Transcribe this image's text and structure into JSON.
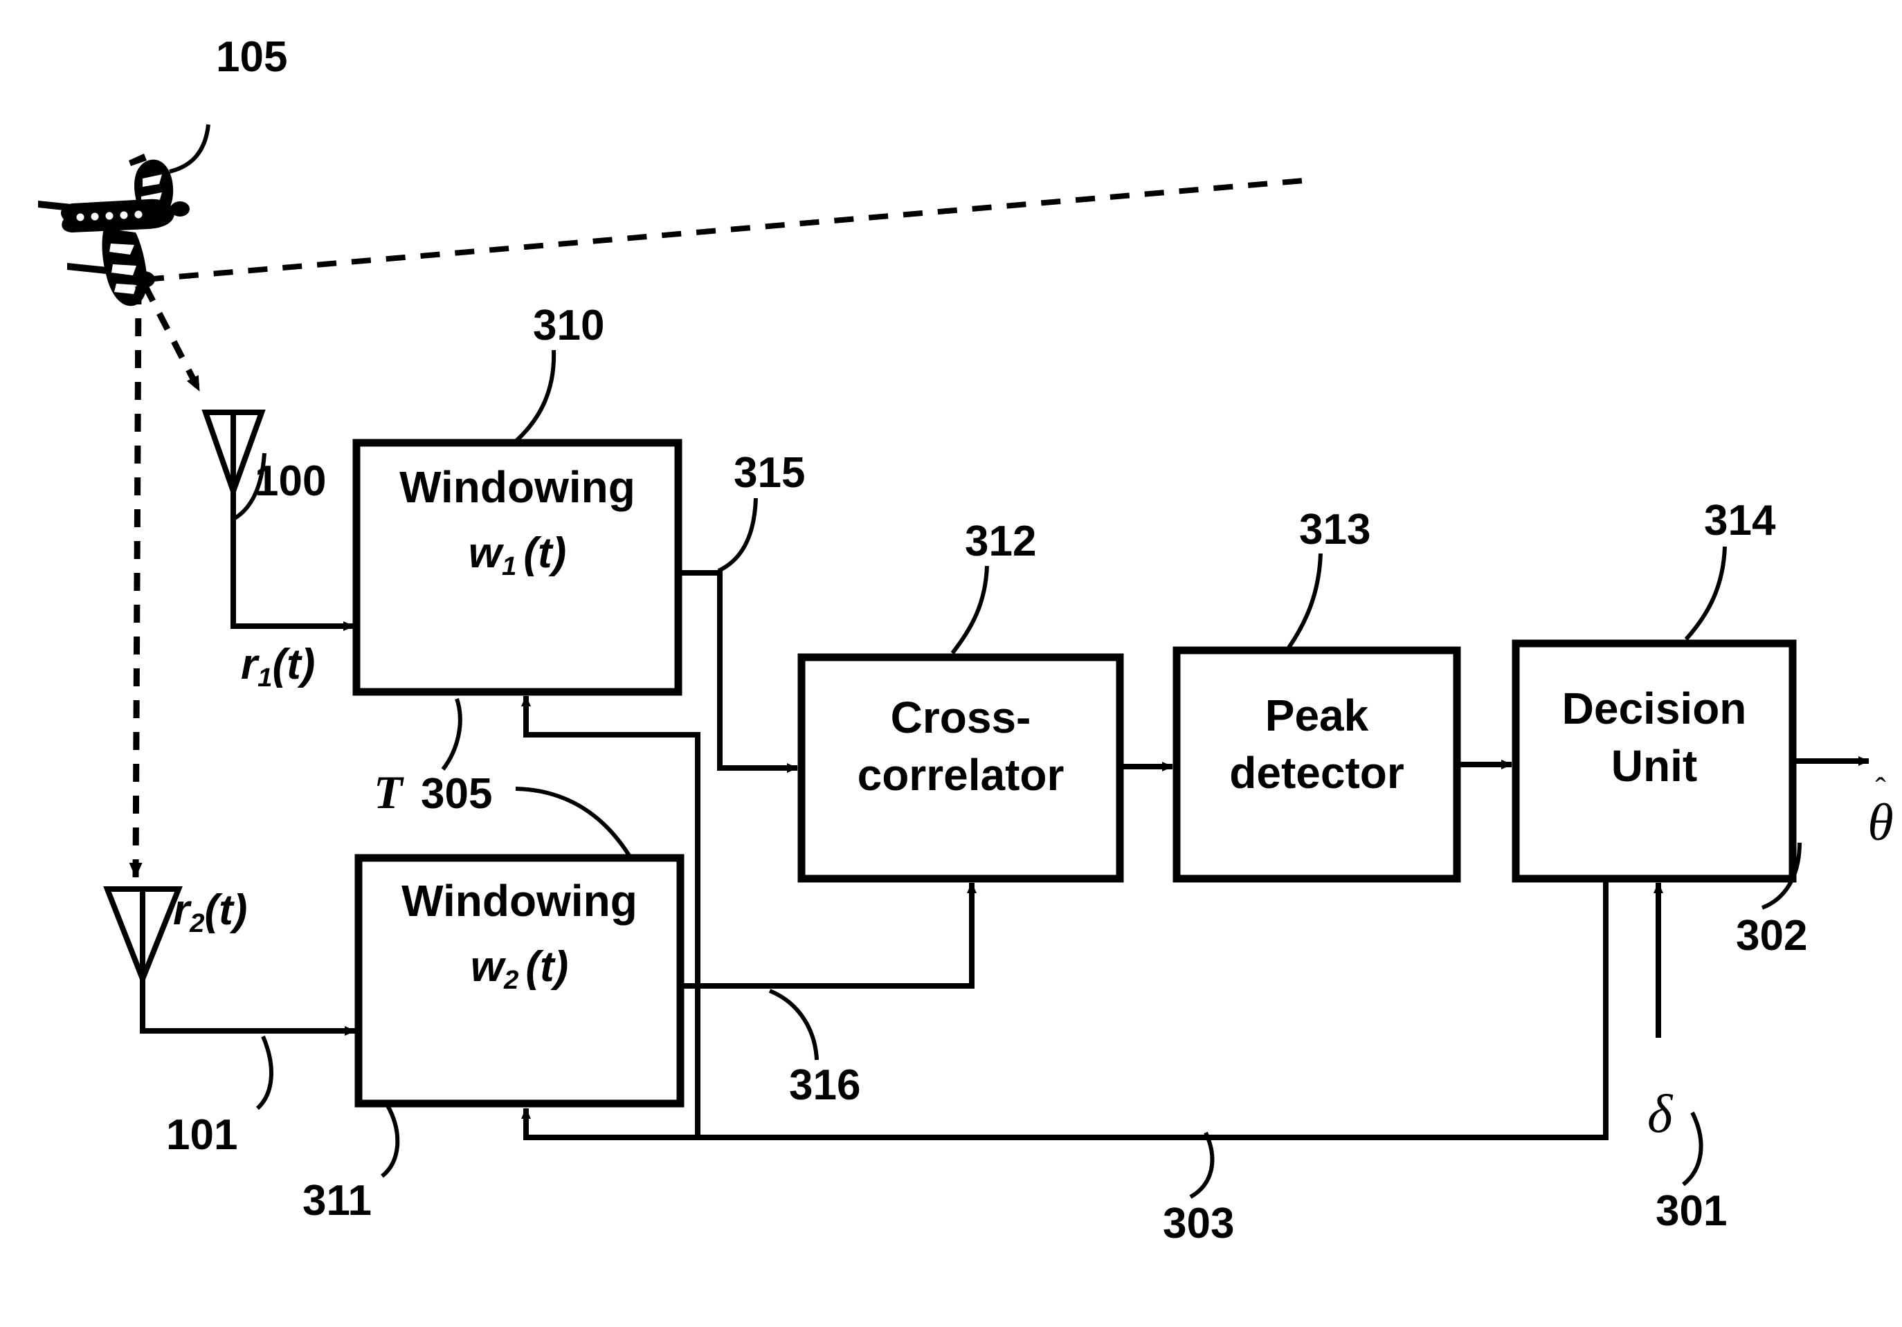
{
  "figure": {
    "type": "patent-block-diagram",
    "background": "#ffffff",
    "stroke": "#000000"
  },
  "scene": {
    "aircraft_ref": "105",
    "antenna1_ref": "100",
    "antenna2_ref": "101",
    "signal1": "r",
    "signal1_sub": "1",
    "signal1_arg": "(t)",
    "signal2": "r",
    "signal2_sub": "2",
    "signal2_arg": "(t)"
  },
  "blocks": [
    {
      "id": "windowing1",
      "ref": "310",
      "line1": "Windowing",
      "line2_base": "w",
      "line2_sub": "1",
      "line2_arg": "(t)"
    },
    {
      "id": "windowing2",
      "ref": "311",
      "line1": "Windowing",
      "line2_base": "w",
      "line2_sub": "2",
      "line2_arg": "(t)"
    },
    {
      "id": "crosscorrelator",
      "ref": "312",
      "line1": "Cross-",
      "line2": "correlator"
    },
    {
      "id": "peakdetector",
      "ref": "313",
      "line1": "Peak",
      "line2": "detector"
    },
    {
      "id": "decisionunit",
      "ref": "314",
      "line1": "Decision",
      "line2": "Unit"
    }
  ],
  "connections": [
    {
      "id": "w1_out",
      "ref": "315"
    },
    {
      "id": "w2_out",
      "ref": "316"
    },
    {
      "id": "window_length",
      "ref": "305",
      "prefix": "T"
    },
    {
      "id": "feedback_303",
      "ref": "303"
    },
    {
      "id": "feedback_301",
      "ref": "301"
    },
    {
      "id": "delta_input",
      "ref": "302"
    }
  ],
  "symbols": {
    "delta": "δ",
    "theta_hat": "θ",
    "theta_hat_accent": "ˆ"
  }
}
